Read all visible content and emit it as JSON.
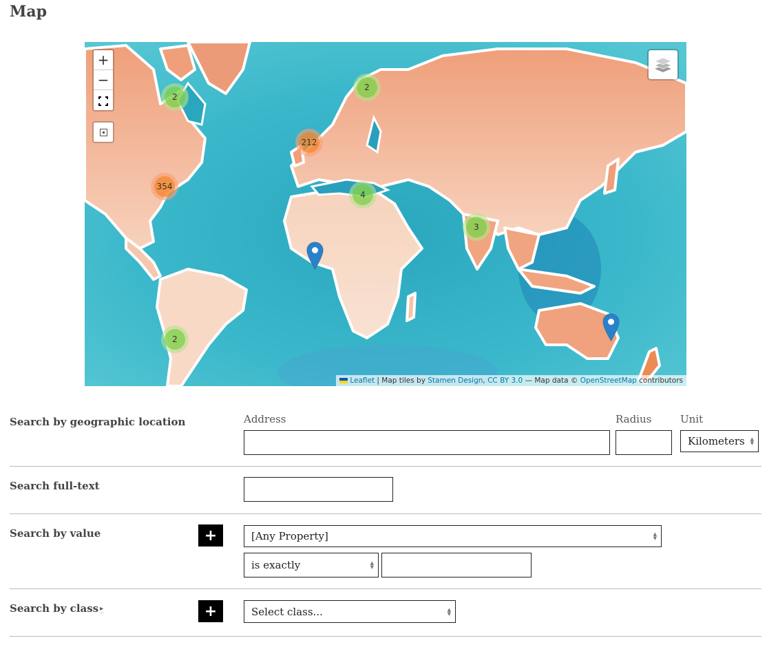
{
  "page": {
    "title": "Map"
  },
  "map": {
    "controls": {
      "zoom_in": "+",
      "zoom_out": "−",
      "fullscreen": "fullscreen-icon",
      "fit_bounds": "fit-bounds-icon",
      "layers": "layers-icon"
    },
    "colors": {
      "sea": "#3cb5c8",
      "land": "#f2b896",
      "cluster_small": "#6ecc39",
      "cluster_medium": "#f18017",
      "marker": "#2a81cb"
    },
    "clusters": [
      {
        "label": "2",
        "size": "small",
        "region": "Canada / Hudson Bay"
      },
      {
        "label": "2",
        "size": "small",
        "region": "Scandinavia"
      },
      {
        "label": "212",
        "size": "medium",
        "region": "Western Europe"
      },
      {
        "label": "354",
        "size": "medium",
        "region": "Eastern United States"
      },
      {
        "label": "4",
        "size": "small",
        "region": "Eastern Mediterranean"
      },
      {
        "label": "3",
        "size": "small",
        "region": "India"
      },
      {
        "label": "2",
        "size": "small",
        "region": "Chile"
      }
    ],
    "markers": [
      {
        "region": "Gulf of Guinea"
      },
      {
        "region": "Eastern Australia"
      }
    ],
    "attribution": {
      "leaflet": "Leaflet",
      "sep1": " | Map tiles by ",
      "stamen": "Stamen Design",
      "comma": ", ",
      "license": "CC BY 3.0",
      "data": " — Map data © ",
      "osm": "OpenStreetMap",
      "contributors": " contributors"
    }
  },
  "form": {
    "geo": {
      "label": "Search by geographic location",
      "address_label": "Address",
      "address_value": "",
      "radius_label": "Radius",
      "radius_value": "",
      "unit_label": "Unit",
      "unit_value": "Kilometers"
    },
    "fulltext": {
      "label": "Search full-text",
      "value": ""
    },
    "value": {
      "label": "Search by value",
      "add_button": "+",
      "property_value": "[Any Property]",
      "operator_value": "is exactly",
      "text_value": ""
    },
    "class": {
      "label": "Search by class",
      "caret": "▸",
      "add_button": "+",
      "select_value": "Select class..."
    }
  }
}
